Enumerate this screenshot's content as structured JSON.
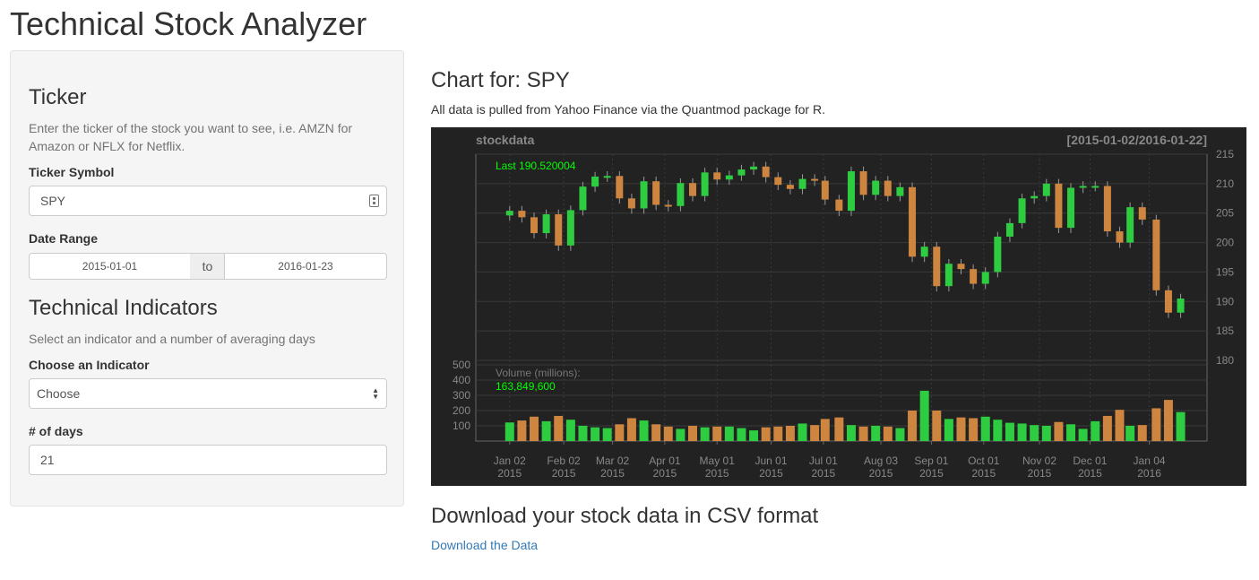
{
  "app": {
    "title": "Technical Stock Analyzer"
  },
  "sidebar": {
    "ticker_heading": "Ticker",
    "ticker_help": "Enter the ticker of the stock you want to see, i.e. AMZN for Amazon or NFLX for Netflix.",
    "ticker_label": "Ticker Symbol",
    "ticker_value": "SPY",
    "date_label": "Date Range",
    "date_start": "2015-01-01",
    "date_sep": "to",
    "date_end": "2016-01-23",
    "indicators_heading": "Technical Indicators",
    "indicators_help": "Select an indicator and a number of averaging days",
    "indicator_label": "Choose an Indicator",
    "indicator_selected": "Choose",
    "days_label": "# of days",
    "days_value": "21"
  },
  "main": {
    "chart_heading": "Chart for: SPY",
    "chart_subtitle": "All data is pulled from Yahoo Finance via the Quantmod package for R.",
    "download_heading": "Download your stock data in CSV format",
    "download_link": "Download the Data"
  },
  "colors": {
    "up": "#2ecc40",
    "down": "#cd853f",
    "chart_bg": "#222222",
    "grid": "#444444",
    "axis_text": "#888888",
    "last_text": "#00ff00",
    "link": "#337ab7"
  },
  "chart_data": {
    "type": "candlestick",
    "title": "stockdata",
    "range_label": "[2015-01-02/2016-01-22]",
    "last_label": "Last 190.520004",
    "volume_label": "Volume (millions):",
    "volume_last": "163,849,600",
    "price_ylim": [
      180,
      215
    ],
    "price_ticks": [
      215,
      210,
      205,
      200,
      195,
      190,
      185,
      180
    ],
    "volume_ylim": [
      0,
      500
    ],
    "volume_ticks": [
      500,
      400,
      300,
      200,
      100
    ],
    "x_ticks": [
      {
        "line1": "Jan 02",
        "line2": "2015",
        "date": "2015-01-02"
      },
      {
        "line1": "Feb 02",
        "line2": "2015",
        "date": "2015-02-02"
      },
      {
        "line1": "Mar 02",
        "line2": "2015",
        "date": "2015-03-02"
      },
      {
        "line1": "Apr 01",
        "line2": "2015",
        "date": "2015-04-01"
      },
      {
        "line1": "May 01",
        "line2": "2015",
        "date": "2015-05-01"
      },
      {
        "line1": "Jun 01",
        "line2": "2015",
        "date": "2015-06-01"
      },
      {
        "line1": "Jul 01",
        "line2": "2015",
        "date": "2015-07-01"
      },
      {
        "line1": "Aug 03",
        "line2": "2015",
        "date": "2015-08-03"
      },
      {
        "line1": "Sep 01",
        "line2": "2015",
        "date": "2015-09-01"
      },
      {
        "line1": "Oct 01",
        "line2": "2015",
        "date": "2015-10-01"
      },
      {
        "line1": "Nov 02",
        "line2": "2015",
        "date": "2015-11-02"
      },
      {
        "line1": "Dec 01",
        "line2": "2015",
        "date": "2015-12-01"
      },
      {
        "line1": "Jan 04",
        "line2": "2016",
        "date": "2016-01-04"
      }
    ],
    "close_series": [
      {
        "date": "2015-01-02",
        "close": 205.4
      },
      {
        "date": "2015-01-09",
        "close": 204.3
      },
      {
        "date": "2015-01-16",
        "close": 201.6
      },
      {
        "date": "2015-01-23",
        "close": 204.8
      },
      {
        "date": "2015-01-30",
        "close": 199.5
      },
      {
        "date": "2015-02-06",
        "close": 205.5
      },
      {
        "date": "2015-02-13",
        "close": 209.5
      },
      {
        "date": "2015-02-20",
        "close": 211.2
      },
      {
        "date": "2015-02-27",
        "close": 211.3
      },
      {
        "date": "2015-03-06",
        "close": 207.5
      },
      {
        "date": "2015-03-13",
        "close": 205.8
      },
      {
        "date": "2015-03-20",
        "close": 210.4
      },
      {
        "date": "2015-03-27",
        "close": 206.4
      },
      {
        "date": "2015-04-03",
        "close": 206.2
      },
      {
        "date": "2015-04-10",
        "close": 210.1
      },
      {
        "date": "2015-04-17",
        "close": 207.9
      },
      {
        "date": "2015-04-24",
        "close": 211.9
      },
      {
        "date": "2015-05-01",
        "close": 210.7
      },
      {
        "date": "2015-05-08",
        "close": 211.4
      },
      {
        "date": "2015-05-15",
        "close": 212.4
      },
      {
        "date": "2015-05-22",
        "close": 212.9
      },
      {
        "date": "2015-05-29",
        "close": 211.1
      },
      {
        "date": "2015-06-05",
        "close": 209.8
      },
      {
        "date": "2015-06-12",
        "close": 209.1
      },
      {
        "date": "2015-06-19",
        "close": 210.8
      },
      {
        "date": "2015-06-26",
        "close": 210.5
      },
      {
        "date": "2015-07-02",
        "close": 207.3
      },
      {
        "date": "2015-07-10",
        "close": 205.4
      },
      {
        "date": "2015-07-17",
        "close": 212.1
      },
      {
        "date": "2015-07-24",
        "close": 208.1
      },
      {
        "date": "2015-07-31",
        "close": 210.5
      },
      {
        "date": "2015-08-07",
        "close": 207.9
      },
      {
        "date": "2015-08-14",
        "close": 209.4
      },
      {
        "date": "2015-08-21",
        "close": 197.6
      },
      {
        "date": "2015-08-28",
        "close": 199.3
      },
      {
        "date": "2015-09-04",
        "close": 192.6
      },
      {
        "date": "2015-09-11",
        "close": 196.4
      },
      {
        "date": "2015-09-18",
        "close": 195.5
      },
      {
        "date": "2015-09-25",
        "close": 193.0
      },
      {
        "date": "2015-10-02",
        "close": 195.0
      },
      {
        "date": "2015-10-09",
        "close": 201.0
      },
      {
        "date": "2015-10-16",
        "close": 203.3
      },
      {
        "date": "2015-10-23",
        "close": 207.5
      },
      {
        "date": "2015-10-30",
        "close": 207.9
      },
      {
        "date": "2015-11-06",
        "close": 210.0
      },
      {
        "date": "2015-11-13",
        "close": 202.5
      },
      {
        "date": "2015-11-20",
        "close": 209.3
      },
      {
        "date": "2015-11-27",
        "close": 209.6
      },
      {
        "date": "2015-12-04",
        "close": 209.6
      },
      {
        "date": "2015-12-11",
        "close": 201.9
      },
      {
        "date": "2015-12-18",
        "close": 200.0
      },
      {
        "date": "2015-12-24",
        "close": 206.0
      },
      {
        "date": "2015-12-31",
        "close": 203.9
      },
      {
        "date": "2016-01-08",
        "close": 191.9
      },
      {
        "date": "2016-01-15",
        "close": 188.1
      },
      {
        "date": "2016-01-22",
        "close": 190.5
      }
    ],
    "volume_series_millions": [
      {
        "date": "2015-01-02",
        "volume": 122
      },
      {
        "date": "2015-01-09",
        "volume": 135
      },
      {
        "date": "2015-01-16",
        "volume": 160
      },
      {
        "date": "2015-01-23",
        "volume": 130
      },
      {
        "date": "2015-01-30",
        "volume": 165
      },
      {
        "date": "2015-02-06",
        "volume": 140
      },
      {
        "date": "2015-02-13",
        "volume": 100
      },
      {
        "date": "2015-02-20",
        "volume": 90
      },
      {
        "date": "2015-02-27",
        "volume": 85
      },
      {
        "date": "2015-03-06",
        "volume": 110
      },
      {
        "date": "2015-03-13",
        "volume": 150
      },
      {
        "date": "2015-03-20",
        "volume": 135
      },
      {
        "date": "2015-03-27",
        "volume": 110
      },
      {
        "date": "2015-04-03",
        "volume": 95
      },
      {
        "date": "2015-04-10",
        "volume": 80
      },
      {
        "date": "2015-04-17",
        "volume": 100
      },
      {
        "date": "2015-04-24",
        "volume": 90
      },
      {
        "date": "2015-05-01",
        "volume": 95
      },
      {
        "date": "2015-05-08",
        "volume": 95
      },
      {
        "date": "2015-05-15",
        "volume": 85
      },
      {
        "date": "2015-05-22",
        "volume": 70
      },
      {
        "date": "2015-05-29",
        "volume": 90
      },
      {
        "date": "2015-06-05",
        "volume": 95
      },
      {
        "date": "2015-06-12",
        "volume": 100
      },
      {
        "date": "2015-06-19",
        "volume": 115
      },
      {
        "date": "2015-06-26",
        "volume": 105
      },
      {
        "date": "2015-07-02",
        "volume": 145
      },
      {
        "date": "2015-07-10",
        "volume": 155
      },
      {
        "date": "2015-07-17",
        "volume": 105
      },
      {
        "date": "2015-07-24",
        "volume": 95
      },
      {
        "date": "2015-07-31",
        "volume": 100
      },
      {
        "date": "2015-08-07",
        "volume": 95
      },
      {
        "date": "2015-08-14",
        "volume": 85
      },
      {
        "date": "2015-08-21",
        "volume": 200
      },
      {
        "date": "2015-08-28",
        "volume": 330
      },
      {
        "date": "2015-09-04",
        "volume": 200
      },
      {
        "date": "2015-09-11",
        "volume": 145
      },
      {
        "date": "2015-09-18",
        "volume": 155
      },
      {
        "date": "2015-09-25",
        "volume": 150
      },
      {
        "date": "2015-10-02",
        "volume": 160
      },
      {
        "date": "2015-10-09",
        "volume": 140
      },
      {
        "date": "2015-10-16",
        "volume": 120
      },
      {
        "date": "2015-10-23",
        "volume": 115
      },
      {
        "date": "2015-10-30",
        "volume": 105
      },
      {
        "date": "2015-11-06",
        "volume": 100
      },
      {
        "date": "2015-11-13",
        "volume": 125
      },
      {
        "date": "2015-11-20",
        "volume": 110
      },
      {
        "date": "2015-11-27",
        "volume": 80
      },
      {
        "date": "2015-12-04",
        "volume": 130
      },
      {
        "date": "2015-12-11",
        "volume": 165
      },
      {
        "date": "2015-12-18",
        "volume": 205
      },
      {
        "date": "2015-12-24",
        "volume": 100
      },
      {
        "date": "2015-12-31",
        "volume": 105
      },
      {
        "date": "2016-01-08",
        "volume": 215
      },
      {
        "date": "2016-01-15",
        "volume": 270
      },
      {
        "date": "2016-01-22",
        "volume": 190
      }
    ]
  }
}
